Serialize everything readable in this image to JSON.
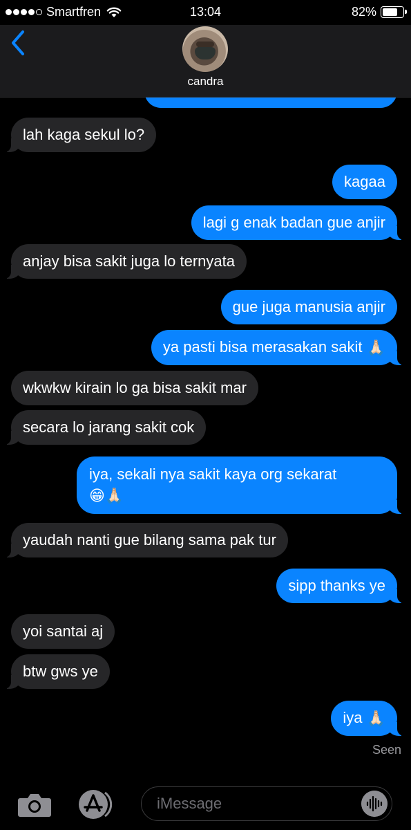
{
  "status_bar": {
    "carrier": "Smartfren",
    "time": "13:04",
    "battery_percent": "82%",
    "battery_level": 0.82,
    "signal_bars_filled": 4,
    "signal_bars_total": 5
  },
  "header": {
    "contact_name": "candra",
    "back_icon": "chevron-left-icon",
    "accent_color": "#0a84ff"
  },
  "messages": [
    {
      "side": "in",
      "text": "lah kaga sekul lo?"
    },
    {
      "side": "out",
      "text": "kagaa"
    },
    {
      "side": "out",
      "text": "lagi g enak badan gue anjir"
    },
    {
      "side": "in",
      "text": "anjay bisa sakit juga lo ternyata"
    },
    {
      "side": "out",
      "text": "gue juga manusia anjir"
    },
    {
      "side": "out",
      "text": "ya pasti bisa merasakan sakit",
      "emoji": "🙏🏻"
    },
    {
      "side": "in",
      "text": "wkwkw kirain lo ga bisa sakit mar"
    },
    {
      "side": "in",
      "text": "secara lo jarang sakit cok"
    },
    {
      "side": "out",
      "text": "iya, sekali nya sakit kaya org sekarat",
      "emoji": "😁🙏🏻"
    },
    {
      "side": "in",
      "text": "yaudah nanti gue bilang sama pak tur"
    },
    {
      "side": "out",
      "text": "sipp thanks ye"
    },
    {
      "side": "in",
      "text": "yoi santai aj"
    },
    {
      "side": "in",
      "text": "btw gws ye"
    },
    {
      "side": "out",
      "text": "iya",
      "emoji": "🙏🏻"
    }
  ],
  "read_receipt": "Seen",
  "input_bar": {
    "placeholder": "iMessage",
    "icons": [
      "camera-icon",
      "app-store-icon",
      "audio-waveform-icon"
    ]
  },
  "colors": {
    "incoming_bubble": "#262628",
    "outgoing_bubble": "#0a84ff",
    "background": "#000000"
  }
}
